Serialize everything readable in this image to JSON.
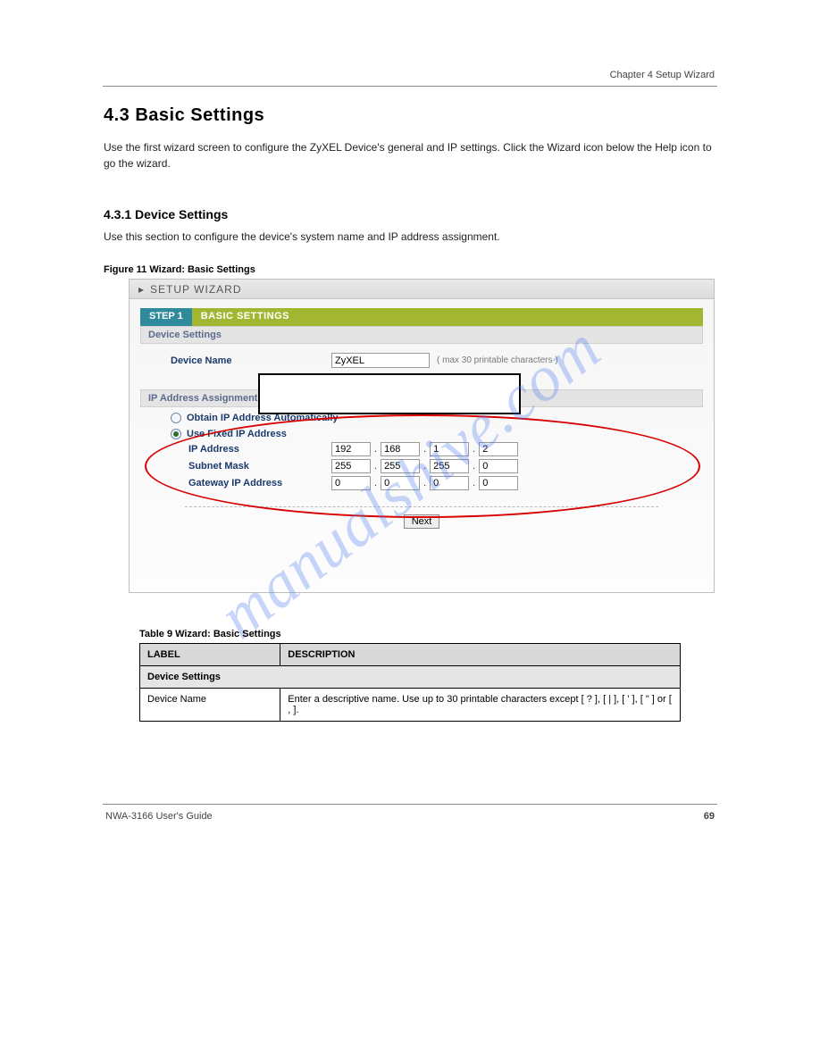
{
  "header_right": "Chapter 4 Setup Wizard",
  "chapter_title": "4.3  Basic Settings",
  "intro": "Use the first wizard screen to configure the ZyXEL Device's general and IP settings. Click the Wizard icon below the Help icon to go the wizard.",
  "subsection": "4.3.1  Device Settings",
  "body": "Use this section to configure the device's system name and IP address assignment.",
  "figure_caption": "Figure 11   Wizard: Basic Settings",
  "wizard": {
    "title": "SETUP WIZARD",
    "step_active": "STEP 1",
    "step_rest": "BASIC SETTINGS",
    "device_settings_header": "Device Settings",
    "device_name_label": "Device Name",
    "device_name_value": "ZyXEL",
    "device_name_hint": "( max 30 printable characters )",
    "ip_header": "IP Address Assignment",
    "radio_auto": "Obtain IP Address Automatically",
    "radio_fixed": "Use Fixed IP Address",
    "ip_address_label": "IP Address",
    "ip_address": [
      "192",
      "168",
      "1",
      "2"
    ],
    "subnet_label": "Subnet Mask",
    "subnet": [
      "255",
      "255",
      "255",
      "0"
    ],
    "gateway_label": "Gateway IP Address",
    "gateway": [
      "0",
      "0",
      "0",
      "0"
    ],
    "next": "Next"
  },
  "watermark": "manualshive.com",
  "table": {
    "caption": "Table 9   Wizard: Basic Settings",
    "col_label": "LABEL",
    "col_desc": "DESCRIPTION",
    "section_row": "Device Settings",
    "row1_label": "Device Name",
    "row1_desc": "Enter a descriptive name. Use up to 30 printable characters except [ ? ], [ | ], [ ' ], [ \" ] or [ , ]."
  },
  "footer_left": "NWA-3166 User's Guide",
  "footer_right": "69"
}
